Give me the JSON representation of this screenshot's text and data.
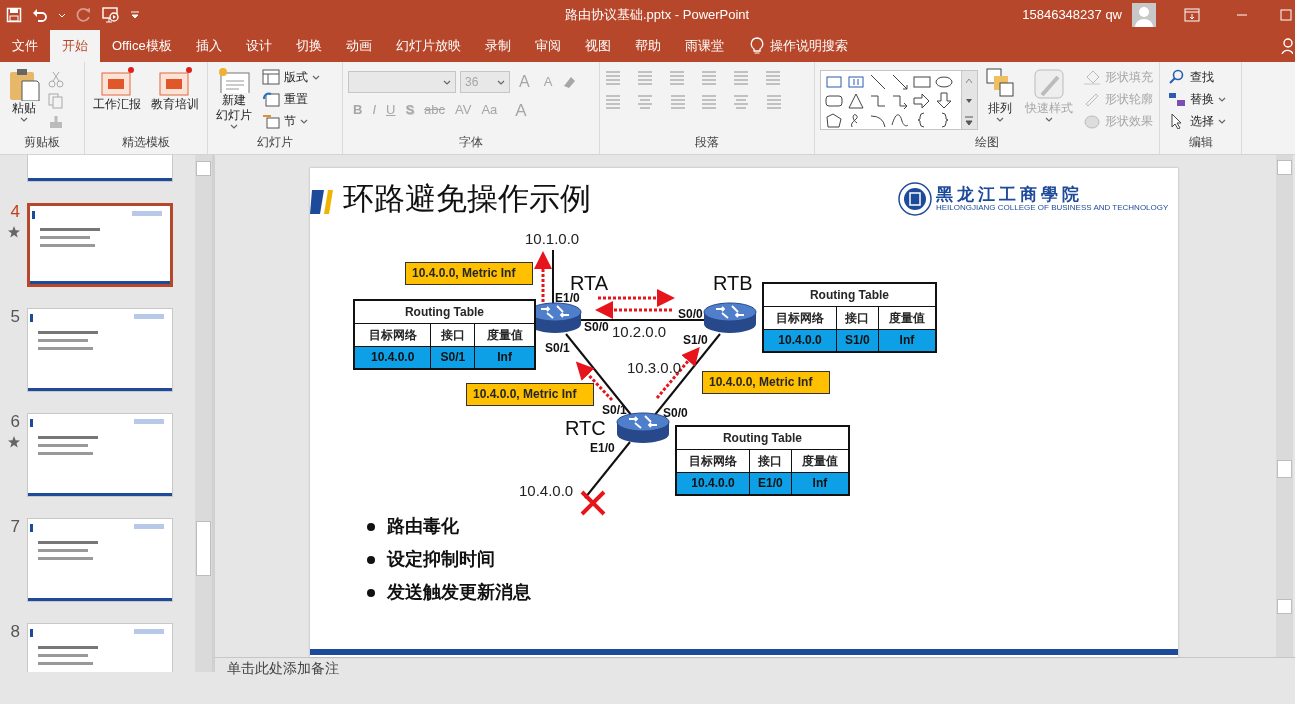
{
  "title_bar": {
    "document_title": "路由协议基础.pptx  -  PowerPoint",
    "account": "15846348237 qw"
  },
  "tabs": [
    {
      "label": "文件",
      "selected": false
    },
    {
      "label": "开始",
      "selected": true
    },
    {
      "label": "Office模板",
      "selected": false
    },
    {
      "label": "插入",
      "selected": false
    },
    {
      "label": "设计",
      "selected": false
    },
    {
      "label": "切换",
      "selected": false
    },
    {
      "label": "动画",
      "selected": false
    },
    {
      "label": "幻灯片放映",
      "selected": false
    },
    {
      "label": "录制",
      "selected": false
    },
    {
      "label": "审阅",
      "selected": false
    },
    {
      "label": "视图",
      "selected": false
    },
    {
      "label": "帮助",
      "selected": false
    },
    {
      "label": "雨课堂",
      "selected": false
    }
  ],
  "tell_me": "操作说明搜索",
  "ribbon": {
    "groups": [
      {
        "label": "剪贴板",
        "buttons": [
          {
            "label": "粘贴",
            "disabled": false
          }
        ]
      },
      {
        "label": "精选模板",
        "buttons": [
          {
            "label": "工作汇报",
            "disabled": false
          },
          {
            "label": "教育培训",
            "disabled": false
          }
        ]
      },
      {
        "label": "幻灯片",
        "buttons": [
          {
            "label_lines": [
              "新建",
              "幻灯片"
            ],
            "disabled": false
          },
          {
            "label": "版式",
            "disabled": false
          },
          {
            "label": "重置",
            "disabled": false
          },
          {
            "label": "节",
            "disabled": false
          }
        ]
      },
      {
        "label": "字体",
        "disabled": true,
        "font_size": "36",
        "size_buttons": [
          "A",
          "A"
        ],
        "format_buttons": [
          "B",
          "I",
          "U",
          "S",
          "abc",
          "AV",
          "Aa",
          "A"
        ]
      },
      {
        "label": "段落",
        "disabled": true
      },
      {
        "label": "绘图",
        "buttons": [
          {
            "label": "排列",
            "disabled": false
          },
          {
            "label": "快速样式",
            "disabled": true
          },
          {
            "label": "形状填充",
            "disabled": true
          },
          {
            "label": "形状轮廓",
            "disabled": true
          },
          {
            "label": "形状效果",
            "disabled": true
          }
        ]
      },
      {
        "label": "编辑",
        "buttons": [
          {
            "label": "查找",
            "disabled": false
          },
          {
            "label": "替换",
            "disabled": false
          },
          {
            "label": "选择",
            "disabled": false
          }
        ]
      }
    ]
  },
  "slides_panel": {
    "slides": [
      {
        "selected": false
      },
      {
        "number": "4",
        "selected": true,
        "animated": true
      },
      {
        "number": "5",
        "selected": false,
        "animated": false
      },
      {
        "number": "6",
        "selected": false,
        "animated": true
      },
      {
        "number": "7",
        "selected": false,
        "animated": false
      },
      {
        "number": "8",
        "selected": false,
        "animated": false
      }
    ]
  },
  "slide": {
    "title": "环路避免操作示例",
    "logo": {
      "name": "黑龙江工商學院",
      "subtitle": "HEILONGJIANG COLLEGE OF BUSINESS AND TECHNOLOGY"
    },
    "diagram": {
      "routers": [
        "RTA",
        "RTB",
        "RTC"
      ],
      "networks": [
        "10.1.0.0",
        "10.2.0.0",
        "10.3.0.0",
        "10.4.0.0"
      ],
      "interfaces": [
        "E1/0",
        "S0/0",
        "S0/1",
        "S0/0",
        "S1/0",
        "S0/1",
        "S0/0",
        "E1/0"
      ],
      "updates": [
        "10.4.0.0, Metric Inf",
        "10.4.0.0, Metric Inf",
        "10.4.0.0, Metric Inf"
      ],
      "link_failed": true,
      "routing_tables": [
        {
          "title": "Routing Table",
          "columns": [
            "目标网络",
            "接口",
            "度量值"
          ],
          "rows": [
            [
              "10.4.0.0",
              "S0/1",
              "Inf"
            ]
          ]
        },
        {
          "title": "Routing Table",
          "columns": [
            "目标网络",
            "接口",
            "度量值"
          ],
          "rows": [
            [
              "10.4.0.0",
              "S1/0",
              "Inf"
            ]
          ]
        },
        {
          "title": "Routing Table",
          "columns": [
            "目标网络",
            "接口",
            "度量值"
          ],
          "rows": [
            [
              "10.4.0.0",
              "E1/0",
              "Inf"
            ]
          ]
        }
      ]
    },
    "bullets": [
      "路由毒化",
      "设定抑制时间",
      "发送触发更新消息"
    ]
  },
  "notes_placeholder": "单击此处添加备注"
}
